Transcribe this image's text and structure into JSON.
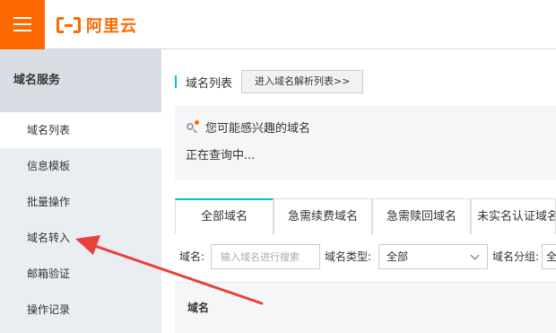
{
  "header": {
    "menu_icon": "hamburger-icon",
    "logo_text": "阿里云",
    "brand_color": "#ff6a00"
  },
  "sidebar": {
    "title": "域名服务",
    "items": [
      {
        "label": "域名列表",
        "active": true
      },
      {
        "label": "信息模板"
      },
      {
        "label": "批量操作"
      },
      {
        "label": "域名转入"
      },
      {
        "label": "邮箱验证"
      },
      {
        "label": "操作记录"
      }
    ]
  },
  "main": {
    "page_title": "域名列表",
    "dns_list_button": "进入域名解析列表>>",
    "suggest": {
      "icon": "search-icon",
      "title": "您可能感兴趣的域名",
      "status": "正在查询中..."
    },
    "tabs": [
      {
        "label": "全部域名",
        "active": true
      },
      {
        "label": "急需续费域名"
      },
      {
        "label": "急需赎回域名"
      },
      {
        "label": "未实名认证域名"
      }
    ],
    "filters": {
      "domain_label": "域名:",
      "domain_placeholder": "输入域名进行搜索",
      "type_label": "域名类型:",
      "type_value": "全部",
      "group_label": "域名分组:",
      "group_value": "全"
    },
    "table": {
      "columns": [
        "域名"
      ]
    }
  },
  "annotation": {
    "arrow_color": "#e8413c"
  },
  "colors": {
    "accent": "#00c1de",
    "sidebar_bg": "#eaedf1"
  }
}
